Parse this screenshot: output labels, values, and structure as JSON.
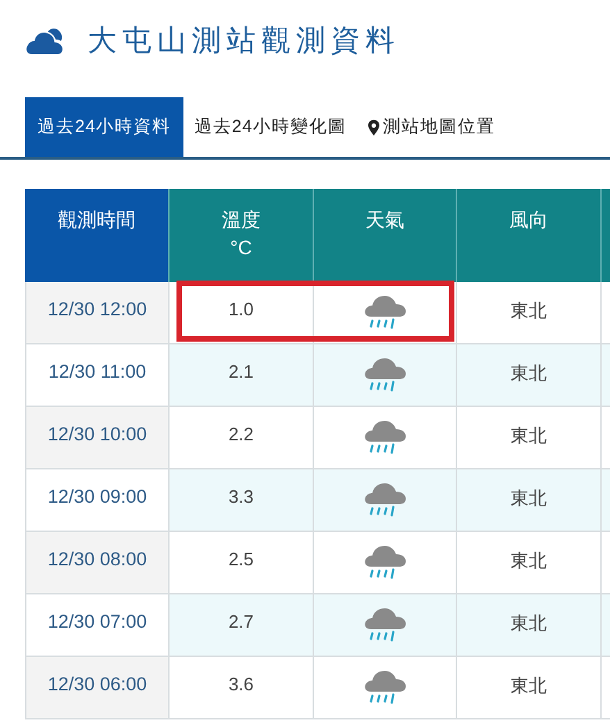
{
  "title": "大屯山測站觀測資料",
  "tabs": [
    {
      "label": "過去24小時資料",
      "selected": true,
      "kind": "plain"
    },
    {
      "label": "過去24小時變化圖",
      "selected": false,
      "kind": "plain"
    },
    {
      "label": "測站地圖位置",
      "selected": false,
      "kind": "location"
    }
  ],
  "table": {
    "columns": [
      {
        "label": "觀測時間",
        "kind": "time"
      },
      {
        "label": "溫度",
        "unit": "°C",
        "kind": "data"
      },
      {
        "label": "天氣",
        "kind": "data"
      },
      {
        "label": "風向",
        "kind": "data"
      }
    ],
    "rows": [
      {
        "time": "12/30 12:00",
        "temperature": "1.0",
        "kind": "rain",
        "wind": "東北",
        "highlighted": true
      },
      {
        "time": "12/30 11:00",
        "temperature": "2.1",
        "kind": "rain",
        "wind": "東北",
        "highlighted": false
      },
      {
        "time": "12/30 10:00",
        "temperature": "2.2",
        "kind": "rain",
        "wind": "東北",
        "highlighted": false
      },
      {
        "time": "12/30 09:00",
        "temperature": "3.3",
        "kind": "rain",
        "wind": "東北",
        "highlighted": false
      },
      {
        "time": "12/30 08:00",
        "temperature": "2.5",
        "kind": "rain",
        "wind": "東北",
        "highlighted": false
      },
      {
        "time": "12/30 07:00",
        "temperature": "2.7",
        "kind": "rain",
        "wind": "東北",
        "highlighted": false
      },
      {
        "time": "12/30 06:00",
        "temperature": "3.6",
        "kind": "rain",
        "wind": "東北",
        "highlighted": false
      }
    ]
  }
}
